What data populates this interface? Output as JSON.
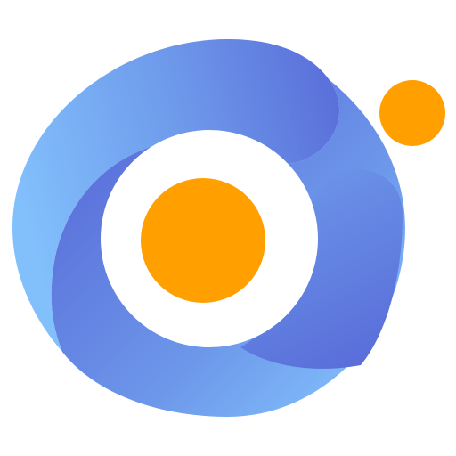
{
  "logo": {
    "icon_name": "swirl-logo-icon",
    "colors": {
      "background": "#FFFFFF",
      "swirl_light": "#82C0FC",
      "swirl_mid": "#6D98EA",
      "swirl_dark": "#5A6FDA",
      "orange": "#FFA000",
      "inner_ring": "#FFFFFF"
    }
  }
}
